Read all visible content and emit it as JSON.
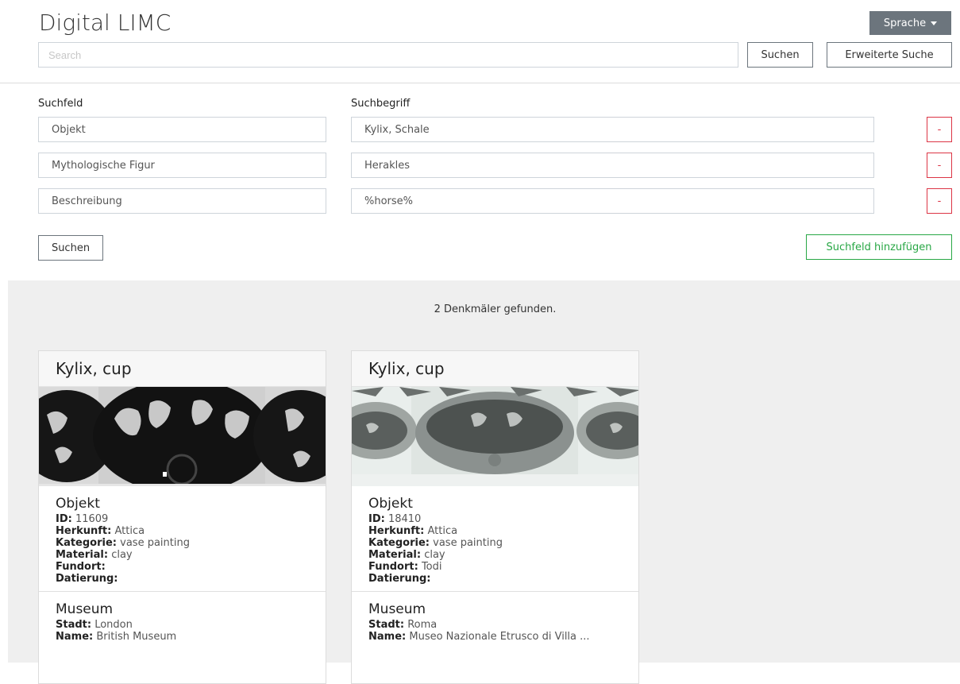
{
  "header": {
    "title": "Digital LIMC",
    "language_button": "Sprache",
    "search_placeholder": "Search",
    "search_button": "Suchen",
    "advanced_button": "Erweiterte Suche"
  },
  "advanced": {
    "field_label": "Suchfeld",
    "term_label": "Suchbegriff",
    "rows": [
      {
        "field": "Objekt",
        "term": "Kylix, Schale",
        "remove": "-"
      },
      {
        "field": "Mythologische Figur",
        "term": "Herakles",
        "remove": "-"
      },
      {
        "field": "Beschreibung",
        "term": "%horse%",
        "remove": "-"
      }
    ],
    "search_button": "Suchen",
    "add_field_button": "Suchfeld hinzufügen"
  },
  "results": {
    "count_text": "2 Denkmäler gefunden.",
    "cards": [
      {
        "title": "Kylix, cup",
        "object_heading": "Objekt",
        "id_label": "ID:",
        "id": "11609",
        "herkunft_label": "Herkunft:",
        "herkunft": "Attica",
        "kategorie_label": "Kategorie:",
        "kategorie": "vase painting",
        "material_label": "Material:",
        "material": "clay",
        "fundort_label": "Fundort:",
        "fundort": "",
        "datierung_label": "Datierung:",
        "datierung": "",
        "museum_heading": "Museum",
        "stadt_label": "Stadt:",
        "stadt": "London",
        "name_label": "Name:",
        "name": "British Museum"
      },
      {
        "title": "Kylix, cup",
        "object_heading": "Objekt",
        "id_label": "ID:",
        "id": "18410",
        "herkunft_label": "Herkunft:",
        "herkunft": "Attica",
        "kategorie_label": "Kategorie:",
        "kategorie": "vase painting",
        "material_label": "Material:",
        "material": "clay",
        "fundort_label": "Fundort:",
        "fundort": "Todi",
        "datierung_label": "Datierung:",
        "datierung": "",
        "museum_heading": "Museum",
        "stadt_label": "Stadt:",
        "stadt": "Roma",
        "name_label": "Name:",
        "name": "Museo Nazionale Etrusco di Villa ..."
      }
    ]
  },
  "colors": {
    "accent_gray": "#6c757d",
    "danger": "#dc3545",
    "success": "#28a745",
    "results_bg": "#efefef"
  },
  "icons": {
    "language_caret": "chevron-down-icon",
    "remove": "minus-icon"
  }
}
